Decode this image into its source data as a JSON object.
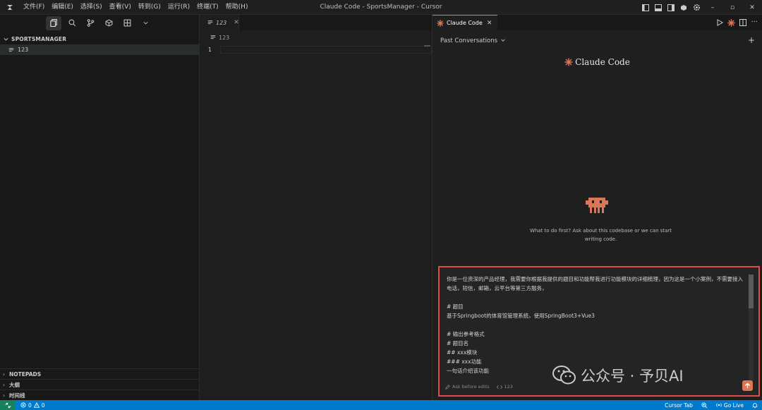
{
  "titlebar": {
    "menu": [
      "文件(F)",
      "编辑(E)",
      "选择(S)",
      "查看(V)",
      "转到(G)",
      "运行(R)",
      "终端(T)",
      "帮助(H)"
    ],
    "title": "Claude Code - SportsManager - Cursor",
    "window_controls": [
      "–",
      "▫",
      "✕"
    ]
  },
  "sidebar": {
    "view_icons": [
      "files-icon",
      "search-icon",
      "source-control-icon",
      "extensions-icon",
      "grid-icon",
      "chevron-down-icon"
    ],
    "section_title": "SPORTSMANAGER",
    "files": [
      {
        "name": "123",
        "icon": "lines-icon"
      }
    ],
    "bottom_sections": [
      "NOTEPADS",
      "大纲",
      "时间线"
    ]
  },
  "editor": {
    "tab_label": "123",
    "breadcrumb": "123",
    "lines": [
      {
        "num": "1",
        "text": ""
      }
    ]
  },
  "panel": {
    "tab_label": "Claude Code",
    "past_conversations": "Past Conversations",
    "brand": "Claude Code",
    "hint": "What to do first? Ask about this codebase or we can start writing code.",
    "input": {
      "text": "你是一位资深的产品经理，我需要你根据我提供的题目和功能帮我进行功能模块的详细梳理，因为这是一个小案例，不需要接入电话，短信，邮箱，云平台等第三方服务，\n\n# 题目\n基于Springboot的体育馆管理系统，使用SpringBoot3+Vue3\n\n# 输出参考格式\n# 题目名\n## xxx模块\n### xxx功能\n一句话介绍该功能",
      "mode": "Ask before edits",
      "file": "123"
    }
  },
  "watermark": "公众号 · 予贝AI",
  "statusbar": {
    "errors": "0",
    "warnings": "0",
    "cursor_tab": "Cursor Tab",
    "go_live": "Go Live"
  },
  "colors": {
    "accent": "#d97757",
    "statusbar": "#007acc",
    "highlight_border": "#e04b4b"
  }
}
